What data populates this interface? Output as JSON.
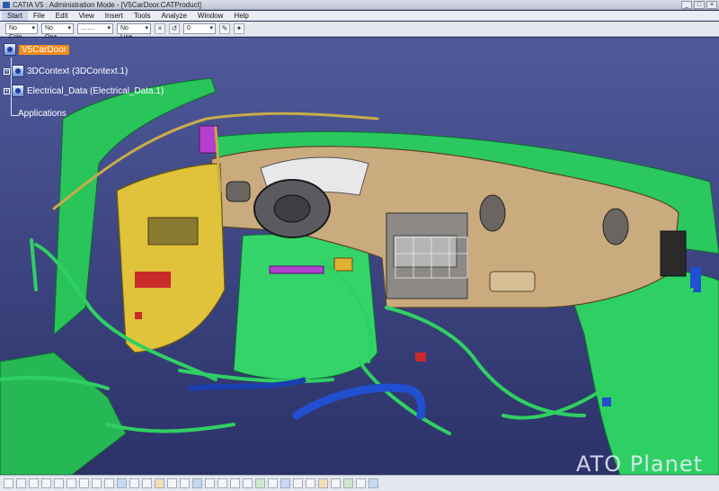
{
  "window": {
    "title": "CATIA V5 : Administration Mode - [V5CarDoor.CATProduct]"
  },
  "menu": [
    "Start",
    "File",
    "Edit",
    "View",
    "Insert",
    "Tools",
    "Analyze",
    "Window",
    "Help"
  ],
  "toolbar": {
    "color_dd": "No Colo",
    "opacity_dd": "No Opa",
    "line_type_dd": "........",
    "line_weight_dd": "No Line",
    "layer_value": "0"
  },
  "tree": {
    "root": "V5CarDoor",
    "children": [
      "3DContext (3DContext.1)",
      "Electrical_Data (Electrical_Data.1)"
    ],
    "applications": "Applications"
  },
  "watermark": {
    "brand": "ATO Planet"
  },
  "colors": {
    "background_top": "#4f5a9a",
    "background_bottom": "#2c3268",
    "harness_green": "#2fd063",
    "dashboard_tan": "#c9ab7e",
    "door_yellow": "#e0c33a",
    "selection_orange": "#f08a1a"
  }
}
